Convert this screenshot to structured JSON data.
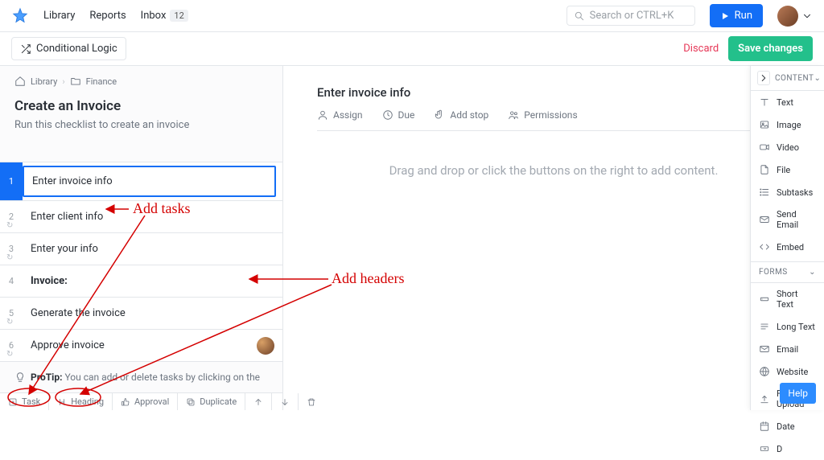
{
  "nav": {
    "library": "Library",
    "reports": "Reports",
    "inbox": "Inbox",
    "inbox_count": "12"
  },
  "search": {
    "placeholder": "Search or CTRL+K"
  },
  "run_button": "Run",
  "second_bar": {
    "conditional_logic": "Conditional Logic",
    "discard": "Discard",
    "save": "Save changes"
  },
  "breadcrumb": {
    "root": "Library",
    "leaf": "Finance"
  },
  "workflow": {
    "title": "Create an Invoice",
    "subtitle": "Run this checklist to create an invoice"
  },
  "tasks": [
    {
      "num": "1",
      "name": "Enter invoice info",
      "selected": true
    },
    {
      "num": "2",
      "name": "Enter client info",
      "loop": true
    },
    {
      "num": "3",
      "name": "Enter your info",
      "loop": true
    },
    {
      "num": "4",
      "name": "Invoice:",
      "header": true
    },
    {
      "num": "5",
      "name": "Generate the invoice",
      "loop": true
    },
    {
      "num": "6",
      "name": "Approve invoice",
      "loop": true,
      "avatar": true
    }
  ],
  "protip": {
    "label": "ProTip:",
    "text": " You can add or delete tasks by clicking on the"
  },
  "bottom_actions": {
    "task": "Task",
    "heading": "Heading",
    "approval": "Approval",
    "duplicate": "Duplicate"
  },
  "center": {
    "title": "Enter invoice info",
    "actions": {
      "assign": "Assign",
      "due": "Due",
      "addstop": "Add stop",
      "permissions": "Permissions"
    },
    "placeholder": "Drag and drop or click the buttons on the right to add content."
  },
  "side_panel": {
    "content_label": "CONTENT",
    "forms_label": "FORMS",
    "content_items": [
      {
        "id": "text",
        "label": "Text"
      },
      {
        "id": "image",
        "label": "Image"
      },
      {
        "id": "video",
        "label": "Video"
      },
      {
        "id": "file",
        "label": "File"
      },
      {
        "id": "subtasks",
        "label": "Subtasks"
      },
      {
        "id": "send-email",
        "label": "Send Email"
      },
      {
        "id": "embed",
        "label": "Embed"
      }
    ],
    "form_items": [
      {
        "id": "short-text",
        "label": "Short Text"
      },
      {
        "id": "long-text",
        "label": "Long Text"
      },
      {
        "id": "email",
        "label": "Email"
      },
      {
        "id": "website",
        "label": "Website"
      },
      {
        "id": "file-upload",
        "label": "File Upload"
      },
      {
        "id": "date",
        "label": "Date"
      },
      {
        "id": "dropdown",
        "label": "D"
      }
    ]
  },
  "annotations": {
    "add_tasks": "Add tasks",
    "add_headers": "Add headers"
  },
  "help": "Help"
}
